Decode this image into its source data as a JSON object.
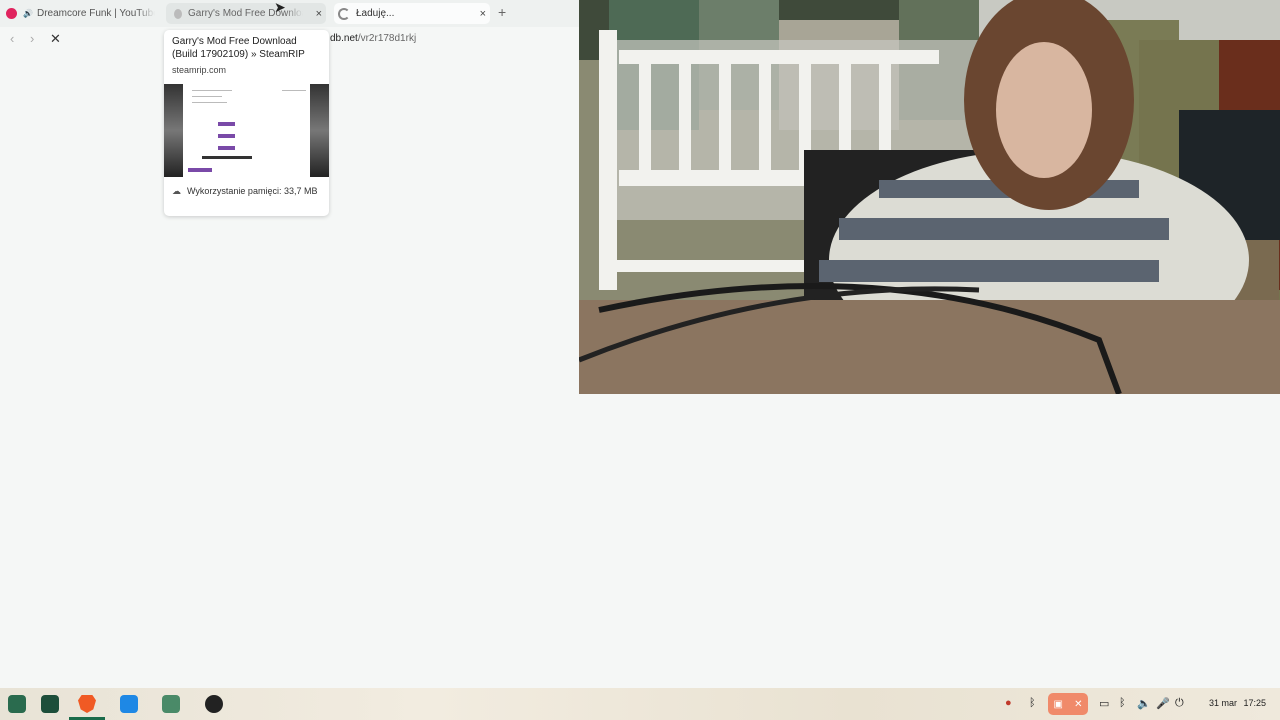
{
  "tabs": [
    {
      "title": "Dreamcore Funk | YouTube",
      "icon": "youtube-icon",
      "color": "#e0245e"
    },
    {
      "title": "Garry's Mod Free Download",
      "icon": "steamrip-icon"
    },
    {
      "title": "Ładuję...",
      "icon": "loading-spinner-icon",
      "close": "×"
    }
  ],
  "tab_close_glyph": "×",
  "new_tab_glyph": "+",
  "url": {
    "domain": "db.net",
    "path": "/vr2r178d1rkj"
  },
  "tab_preview": {
    "title": "Garry's Mod Free Download (Build 17902109) » SteamRIP",
    "domain": "steamrip.com",
    "memory": "Wykorzystanie pamięci: 33,7 MB"
  },
  "taskbar": {
    "clock_date": "31 mar",
    "clock_time": "17:25",
    "accent": "#f08a6a"
  }
}
